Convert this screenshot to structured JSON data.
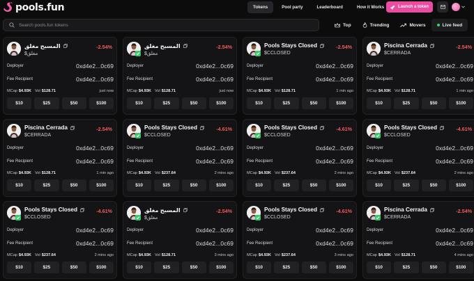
{
  "header": {
    "brand": "pools.fun",
    "nav": [
      {
        "label": "Tokens",
        "active": true
      },
      {
        "label": "Pool party",
        "active": false
      },
      {
        "label": "Leaderboard",
        "active": false
      },
      {
        "label": "How it Works",
        "active": false
      }
    ],
    "launch_label": "Launch a token",
    "accent_color": "#ec4ba0"
  },
  "search": {
    "placeholder": "Search pools.fun tokens"
  },
  "filters": [
    {
      "label": "Top",
      "icon": "crown-icon"
    },
    {
      "label": "Trending",
      "icon": "flame-icon"
    },
    {
      "label": "Movers",
      "icon": "trend-icon"
    },
    {
      "label": "Live feed",
      "icon": "live-dot",
      "active": true
    }
  ],
  "labels": {
    "deployer": "Deployer",
    "fee_recipient": "Fee Recipient",
    "mcap": "MCap",
    "vol": "Vol"
  },
  "buy_amounts": [
    "$10",
    "$25",
    "$50",
    "$100"
  ],
  "cards": [
    {
      "name": "المسبح مغلق",
      "ticker": "$مغلق",
      "change": "-2.54%",
      "deployer": "0xd4e2...0c69",
      "fee": "0xd4e2...0c69",
      "mcap": "$4.93K",
      "vol": "$128.71",
      "time": "just now",
      "avatar": "person",
      "verified": false
    },
    {
      "name": "المسبح مغلق",
      "ticker": "$مغلق",
      "change": "-2.54%",
      "deployer": "0xd4e2...0c69",
      "fee": "0xd4e2...0c69",
      "mcap": "$4.93K",
      "vol": "$128.71",
      "time": "just now",
      "avatar": "person",
      "verified": true
    },
    {
      "name": "Pools Stays Closed",
      "ticker": "$CCLOSED",
      "change": "-2.54%",
      "deployer": "0xd4e2...0c69",
      "fee": "0xd4e2...0c69",
      "mcap": "$4.93K",
      "vol": "$128.71",
      "time": "1 min ago",
      "avatar": "person",
      "verified": true
    },
    {
      "name": "Piscina Cerrada",
      "ticker": "$CERRADA",
      "change": "-2.54%",
      "deployer": "0xd4e2...0c69",
      "fee": "0xd4e2...0c69",
      "mcap": "$4.93K",
      "vol": "$128.71",
      "time": "1 min ago",
      "avatar": "person",
      "verified": false
    },
    {
      "name": "Piscina Cerrada",
      "ticker": "$CERRADA",
      "change": "-2.54%",
      "deployer": "0xd4e2...0c69",
      "fee": "0xd4e2...0c69",
      "mcap": "$4.93K",
      "vol": "$128.71",
      "time": "1 min ago",
      "avatar": "person",
      "verified": false
    },
    {
      "name": "Pools Stays Closed",
      "ticker": "$CCLOSED",
      "change": "-4.61%",
      "deployer": "0xd4e2...0c69",
      "fee": "0xd4e2...0c69",
      "mcap": "$4.93K",
      "vol": "$237.64",
      "time": "2 mins ago",
      "avatar": "person",
      "verified": true
    },
    {
      "name": "Pools Stays Closed",
      "ticker": "$CCLOSED",
      "change": "-4.61%",
      "deployer": "0xd4e2...0c69",
      "fee": "0xd4e2...0c69",
      "mcap": "$4.93K",
      "vol": "$237.64",
      "time": "2 mins ago",
      "avatar": "person",
      "verified": true
    },
    {
      "name": "Pools Stays Closed",
      "ticker": "$CCLOSED",
      "change": "-4.61%",
      "deployer": "0xd4e2...0c69",
      "fee": "0xd4e2...0c69",
      "mcap": "$4.93K",
      "vol": "$237.64",
      "time": "2 mins ago",
      "avatar": "person",
      "verified": true
    },
    {
      "name": "Pools Stays Closed",
      "ticker": "$CCLOSED",
      "change": "-4.61%",
      "deployer": "0xd4e2...0c69",
      "fee": "0xd4e2...0c69",
      "mcap": "$4.93K",
      "vol": "$237.64",
      "time": "2 mins ago",
      "avatar": "person",
      "verified": true
    },
    {
      "name": "المسبح مغلق",
      "ticker": "$مغلق",
      "change": "-2.54%",
      "deployer": "0xd4e2...0c69",
      "fee": "0xd4e2...0c69",
      "mcap": "$4.93K",
      "vol": "$128.71",
      "time": "3 mins ago",
      "avatar": "person",
      "verified": true
    },
    {
      "name": "Pools Stays Closed",
      "ticker": "$CCLOSED",
      "change": "-4.61%",
      "deployer": "0xd4e2...0c69",
      "fee": "0xd4e2...0c69",
      "mcap": "$4.93K",
      "vol": "$237.64",
      "time": "3 mins ago",
      "avatar": "person",
      "verified": true
    },
    {
      "name": "Piscina Cerrada",
      "ticker": "$CERRADA",
      "change": "-2.54%",
      "deployer": "0xd4e2...0c69",
      "fee": "0xd4e2...0c69",
      "mcap": "$4.93K",
      "vol": "$128.71",
      "time": "4 mins ago",
      "avatar": "person",
      "verified": true
    }
  ]
}
